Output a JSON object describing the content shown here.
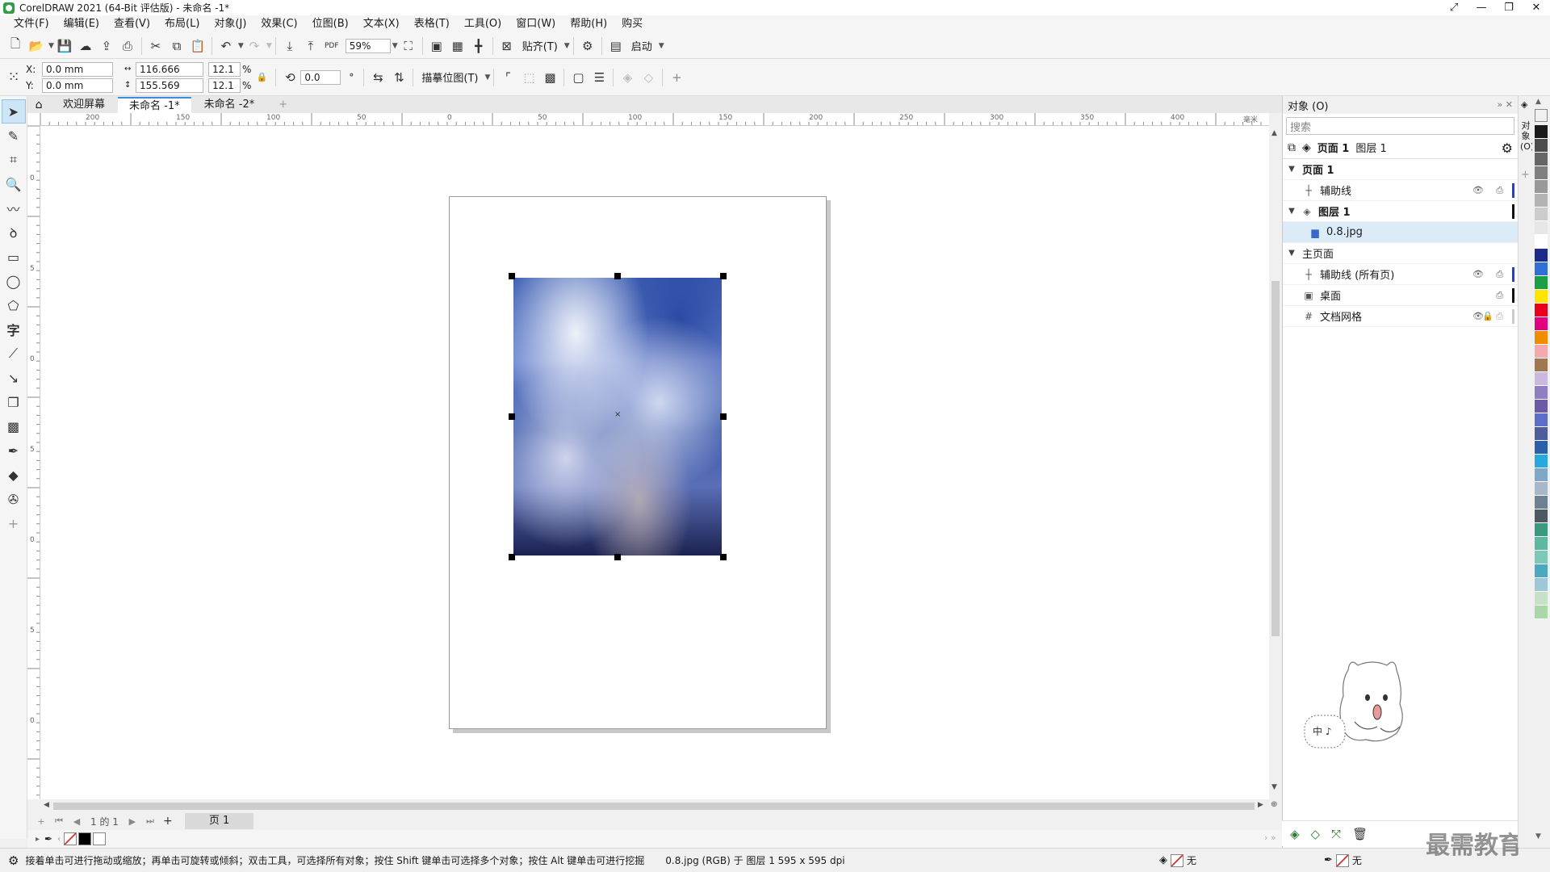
{
  "window": {
    "title": "CorelDRAW 2021 (64-Bit 评估版) - 未命名 -1*",
    "controls": [
      "⤢",
      "—",
      "❐",
      "✕"
    ]
  },
  "menu": [
    "文件(F)",
    "编辑(E)",
    "查看(V)",
    "布局(L)",
    "对象(J)",
    "效果(C)",
    "位图(B)",
    "文本(X)",
    "表格(T)",
    "工具(O)",
    "窗口(W)",
    "帮助(H)",
    "购买"
  ],
  "toolbar1": {
    "zoom": "59%",
    "snap_label": "贴齐(T)",
    "launch_label": "启动",
    "pdf_label": "PDF"
  },
  "toolbar2": {
    "x_label": "X:",
    "y_label": "Y:",
    "x": "0.0 mm",
    "y": "0.0 mm",
    "width": "116.666 mm",
    "height": "155.569 mm",
    "scale_x": "12.1",
    "scale_y": "12.1",
    "percent": "%",
    "rotation": "0.0",
    "degree": "°",
    "trace_label": "描摹位图(T)"
  },
  "tabs": {
    "welcome": "欢迎屏幕",
    "doc1": "未命名 -1*",
    "doc2": "未命名 -2*",
    "add": "+"
  },
  "ruler": {
    "h_labels": [
      "200",
      "150",
      "100",
      "50",
      "0",
      "50",
      "100",
      "150",
      "200",
      "250",
      "300",
      "350",
      "400"
    ],
    "unit": "毫米",
    "v_labels": [
      "0",
      "5",
      "0",
      "5",
      "0",
      "5",
      "0",
      "5",
      "0",
      "5",
      "0",
      "5",
      "0"
    ]
  },
  "pagenav": {
    "page_of": "1 的 1",
    "page_tab": "页 1"
  },
  "status": {
    "hint": "接着单击可进行拖动或缩放；再单击可旋转或倾斜；双击工具，可选择所有对象；按住 Shift 键单击可选择多个对象；按住 Alt 键单击可进行挖掘",
    "object_info": "0.8.jpg (RGB) 于 图层 1 595 x 595 dpi",
    "fill_label": "无",
    "outline_label": "无"
  },
  "objects_docker": {
    "title": "对象 (O)",
    "search_placeholder": "搜索",
    "crumb_page": "页面 1",
    "crumb_layer": "图层 1",
    "side_tab": "对象(O)",
    "rows": [
      {
        "label": "页面 1",
        "level": 0,
        "bold": true
      },
      {
        "label": "辅助线",
        "level": 1,
        "bold": false
      },
      {
        "label": "图层 1",
        "level": 1,
        "bold": true
      },
      {
        "label": "0.8.jpg",
        "level": 2,
        "bold": false
      },
      {
        "label": "主页面",
        "level": 0,
        "bold": false
      },
      {
        "label": "辅助线 (所有页)",
        "level": 1,
        "bold": false
      },
      {
        "label": "桌面",
        "level": 1,
        "bold": false
      },
      {
        "label": "文档网格",
        "level": 1,
        "bold": false
      }
    ]
  },
  "mascot": {
    "bubble_text": "中 ♪"
  },
  "watermark": "最需教育",
  "colors": {
    "accent": "#3c8ddc",
    "palette": [
      "#1a1a1a",
      "#4d4d4d",
      "#666666",
      "#808080",
      "#999999",
      "#b3b3b3",
      "#cccccc",
      "#e6e6e6",
      "#ffffff",
      "#1c2a8c",
      "#2f6fd6",
      "#1c9e48",
      "#ffe400",
      "#e8001c",
      "#e3007e",
      "#f08c00",
      "#f4a9b0",
      "#a07850",
      "#c9b9e0",
      "#8d7fc2",
      "#6b5aa8",
      "#5b6ec8",
      "#4f5d9e",
      "#2b5fa8",
      "#28a8e0",
      "#7fa8c8",
      "#a8b8c8",
      "#6f8090",
      "#4d5a66",
      "#3a9a80",
      "#5cb8a0",
      "#7ec8b8",
      "#4aa8c0",
      "#9ec8d8",
      "#c8e0c8",
      "#a8d8a8"
    ]
  }
}
